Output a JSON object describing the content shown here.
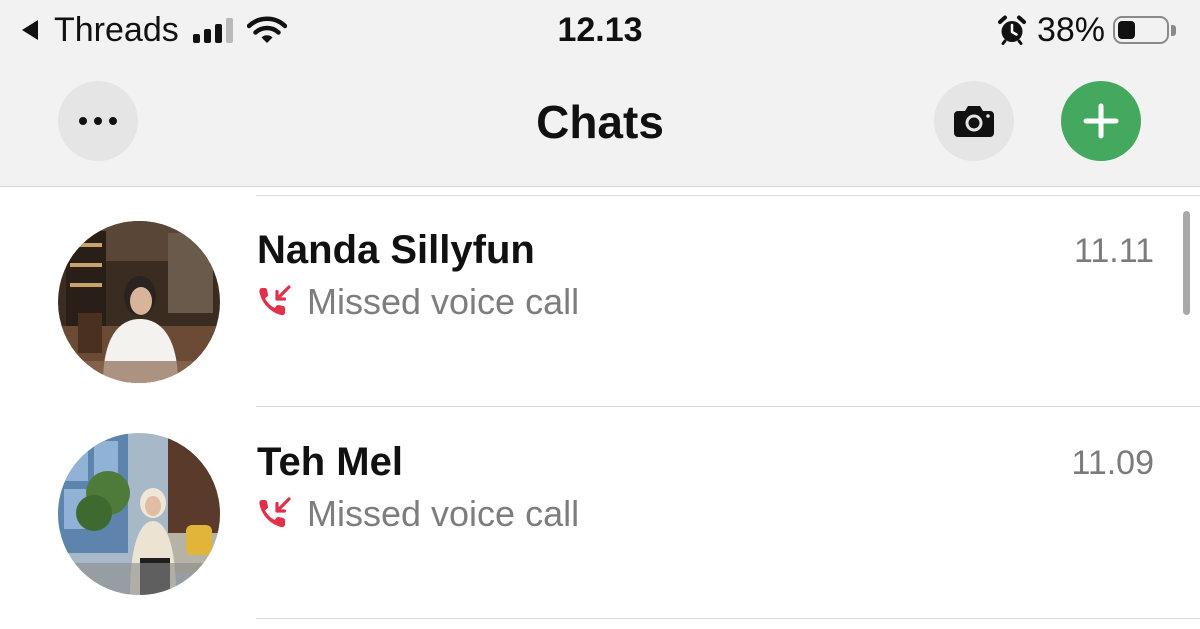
{
  "status_bar": {
    "back_app": "Threads",
    "time": "12.13",
    "battery_percent": "38%",
    "battery_level": 0.38,
    "icons": [
      "back-caret-icon",
      "cellular-signal-icon",
      "wifi-icon",
      "alarm-icon",
      "battery-icon"
    ]
  },
  "nav": {
    "title": "Chats",
    "left_button_icon": "more-dots-icon",
    "camera_button_icon": "camera-icon",
    "add_button_icon": "plus-icon"
  },
  "colors": {
    "accent_green": "#44a85f",
    "missed_call_red": "#e0304a",
    "secondary_text": "#7d7d7d",
    "bar_background": "#f2f2f2"
  },
  "chats": [
    {
      "name": "Nanda Sillyfun",
      "time": "11.11",
      "preview": "Missed voice call",
      "preview_icon": "missed-call-icon",
      "avatar": "contact-photo"
    },
    {
      "name": "Teh Mel",
      "time": "11.09",
      "preview": "Missed voice call",
      "preview_icon": "missed-call-icon",
      "avatar": "contact-photo"
    }
  ]
}
